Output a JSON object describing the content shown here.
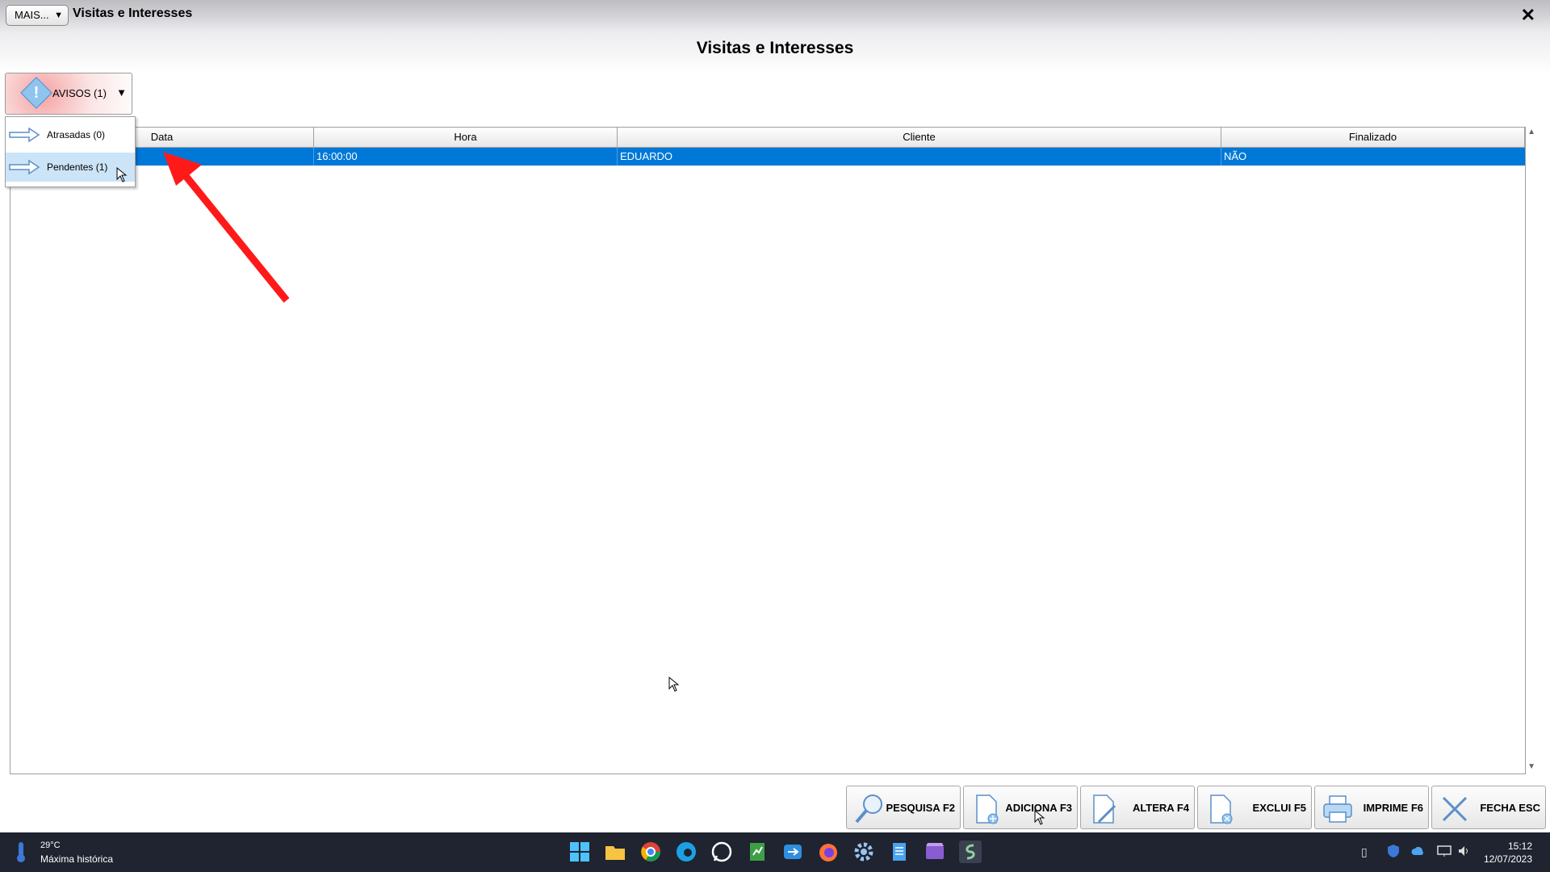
{
  "window": {
    "mais_label": "MAIS...",
    "title": "Visitas e Interesses",
    "close_glyph": "✕"
  },
  "page": {
    "title": "Visitas e Interesses"
  },
  "avisos": {
    "label": "AVISOS (1)",
    "icon": "warning-diamond-icon",
    "menu": [
      {
        "label": "Atrasadas (0)",
        "selected": false
      },
      {
        "label": "Pendentes (1)",
        "selected": true
      }
    ]
  },
  "grid": {
    "columns": [
      "Data",
      "Hora",
      "Cliente",
      "Finalizado"
    ],
    "rows": [
      {
        "data": "",
        "hora": "16:00:00",
        "cliente": "EDUARDO",
        "finalizado": "NÃO",
        "selected": true
      }
    ]
  },
  "toolbar": {
    "pesquisa": "PESQUISA F2",
    "adiciona": "ADICIONA F3",
    "altera": "ALTERA F4",
    "exclui": "EXCLUI F5",
    "imprime": "IMPRIME F6",
    "fecha": "FECHA ESC"
  },
  "taskbar": {
    "temperature": "29°C",
    "weather": "Máxima histórica",
    "time": "15:12",
    "date": "12/07/2023"
  },
  "colors": {
    "selection": "#0078d7",
    "annotation_arrow": "#ff0000",
    "taskbar": "#1f2430"
  }
}
